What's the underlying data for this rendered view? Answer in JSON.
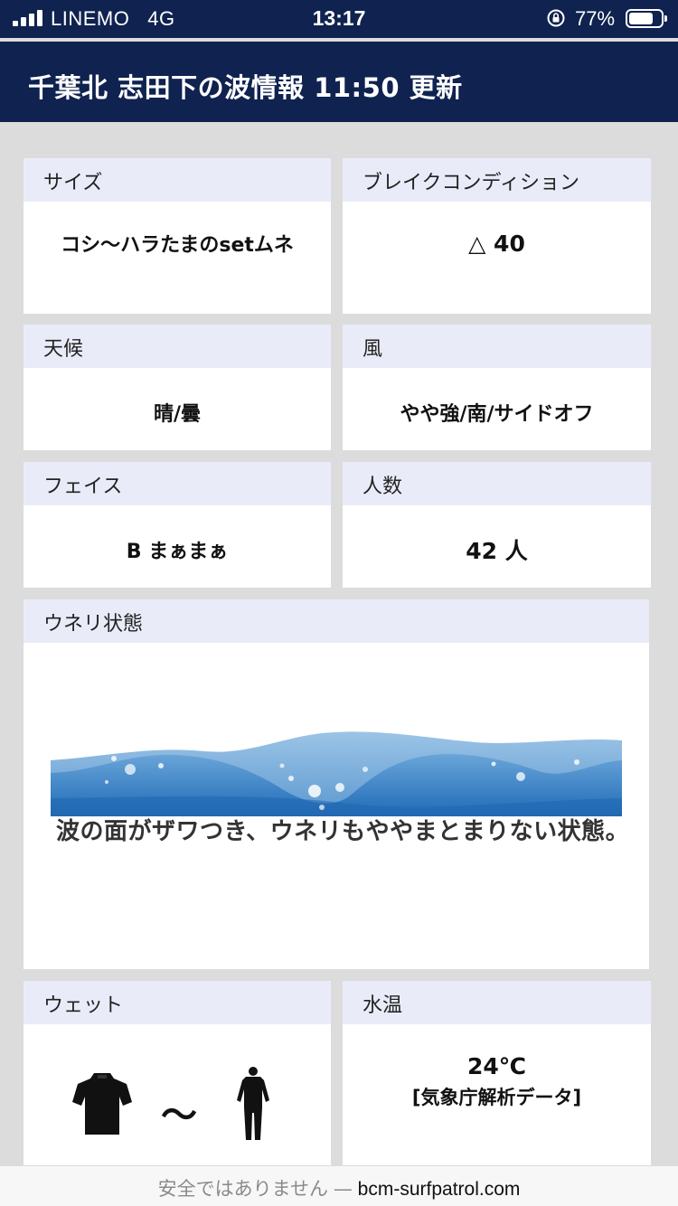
{
  "status": {
    "carrier": "LINEMO",
    "network": "4G",
    "time": "13:17",
    "battery_percent": "77%",
    "battery_level": 0.77
  },
  "header": {
    "title": "千葉北 志田下の波情報 11:50 更新"
  },
  "cards": {
    "size": {
      "label": "サイズ",
      "value": "コシ〜ハラたまのsetムネ"
    },
    "break": {
      "label": "ブレイクコンディション",
      "value": "△ 40"
    },
    "weather": {
      "label": "天候",
      "value": "晴/曇"
    },
    "wind": {
      "label": "風",
      "value": "やや強/南/サイドオフ"
    },
    "face": {
      "label": "フェイス",
      "value": "B まぁまぁ"
    },
    "people": {
      "label": "人数",
      "value": "42 人"
    },
    "swell": {
      "label": "ウネリ状態",
      "caption": "波の面がザワつき、ウネリもややまとまりない状態。"
    },
    "wetsuit": {
      "label": "ウェット",
      "separator": "〜"
    },
    "water": {
      "label": "水温",
      "temp": "24℃",
      "source": "[気象庁解析データ]"
    }
  },
  "browser": {
    "security_warning": "安全ではありません",
    "dash": "—",
    "domain": "bcm-surfpatrol.com"
  }
}
